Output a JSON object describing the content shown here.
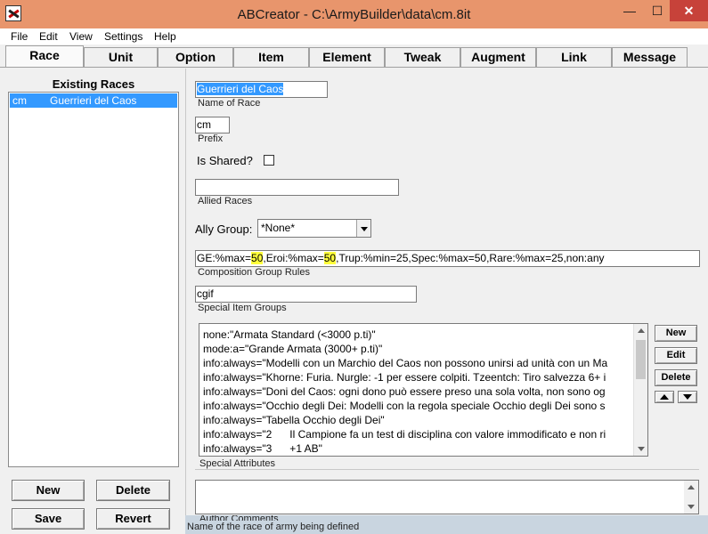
{
  "window": {
    "title": "ABCreator - C:\\ArmyBuilder\\data\\cm.8it",
    "min_glyph": "—",
    "max_glyph": "☐",
    "close_glyph": "✕",
    "icon": "app-icon"
  },
  "menu": [
    "File",
    "Edit",
    "View",
    "Settings",
    "Help"
  ],
  "tabs": [
    "Race",
    "Unit",
    "Option",
    "Item",
    "Element",
    "Tweak",
    "Augment",
    "Link",
    "Message"
  ],
  "active_tab": "Race",
  "left_panel": {
    "title": "Existing Races",
    "races": [
      {
        "prefix": "cm",
        "name": "Guerrieri del Caos",
        "selected": true
      }
    ],
    "buttons": {
      "new": "New",
      "delete": "Delete",
      "save": "Save",
      "revert": "Revert"
    }
  },
  "form": {
    "race_name": {
      "value": "Guerrieri del Caos",
      "caption": "Name of Race"
    },
    "prefix": {
      "value": "cm",
      "caption": "Prefix"
    },
    "is_shared": {
      "label": "Is Shared?",
      "checked": false
    },
    "allied_races": {
      "value": "",
      "caption": "Allied Races"
    },
    "ally_group": {
      "label": "Ally Group:",
      "value": "*None*"
    },
    "composition": {
      "parts": [
        "GE:%max=",
        "50",
        ",Eroi:%max=",
        "50",
        ",Trup:%min=25,Spec:%max=50,Rare:%max=25,non:any"
      ],
      "caption": "Composition Group Rules"
    },
    "special_item_groups": {
      "value": "cgif",
      "caption": "Special Item Groups"
    },
    "special_attributes": {
      "caption": "Special Attributes",
      "lines": [
        "none:\"Armata Standard (<3000 p.ti)\"",
        "mode:a=\"Grande Armata (3000+ p.ti)\"",
        "info:always=\"Modelli con un Marchio del Caos non possono unirsi ad unità con un Ma",
        "info:always=\"Khorne: Furia. Nurgle: -1 per essere colpiti. Tzeentch: Tiro salvezza 6+ i",
        "info:always=\"Doni del Caos: ogni dono può essere preso una sola volta, non sono og",
        "info:always=\"Occhio degli Dei: Modelli con la regola speciale Occhio degli Dei sono s",
        "info:always=\"Tabella Occhio degli Dei\"",
        "info:always=\"2      Il Campione fa un test di disciplina con valore immodificato e non ri",
        "info:always=\"3      +1 AB\""
      ],
      "buttons": {
        "new": "New",
        "edit": "Edit",
        "delete": "Delete"
      }
    },
    "author_comments": {
      "value": "",
      "caption": "Author Comments"
    }
  },
  "status": "Name of the race of army being defined",
  "colors": {
    "titlebar": "#e8956c",
    "close": "#c7423a",
    "selection": "#3399ff",
    "highlight": "#ffff3b"
  }
}
